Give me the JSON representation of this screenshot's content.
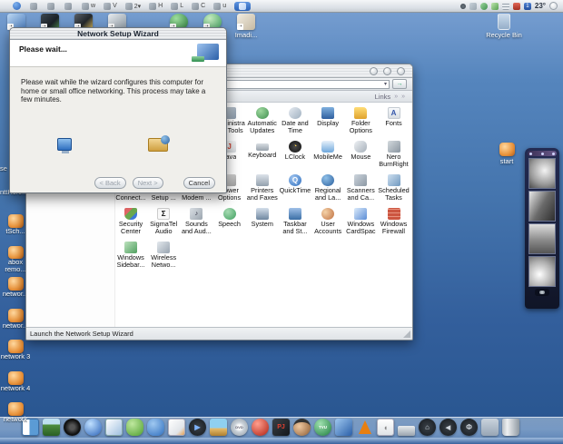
{
  "menubar": {
    "temperature": "23°",
    "extras": [
      {
        "icon": "menu-grid"
      },
      {
        "icon": "menu-disc"
      },
      {
        "icon": "menu-doc"
      },
      {
        "icon": "menu-drive",
        "label": "w"
      },
      {
        "icon": "menu-display",
        "label": "V"
      },
      {
        "icon": "menu-orb",
        "label": "2▾"
      },
      {
        "icon": "menu-orb2",
        "label": "H"
      },
      {
        "icon": "menu-sq",
        "label": "L"
      },
      {
        "icon": "menu-sq2",
        "label": "C"
      },
      {
        "icon": "menu-up",
        "label": "u"
      }
    ],
    "active_extra": {
      "icon": "menu-keyboard"
    },
    "tray": [
      {
        "icon": "tray-dot"
      },
      {
        "icon": "tray-net"
      },
      {
        "icon": "tray-user-green"
      },
      {
        "icon": "tray-win-green"
      },
      {
        "icon": "tray-eq"
      },
      {
        "icon": "tray-battery-red"
      },
      {
        "icon": "tray-lang-blue",
        "label": "1"
      }
    ]
  },
  "desktop": {
    "top_shortcuts_a": [
      {
        "icon": "app-blue",
        "label": ""
      },
      {
        "icon": "app-dark",
        "label": ""
      },
      {
        "icon": "app-yellow",
        "label": ""
      },
      {
        "icon": "app-gray",
        "label": ""
      }
    ],
    "top_shortcuts_b": [
      {
        "icon": "orb-green",
        "label": ""
      },
      {
        "icon": "sphere-green",
        "label": ""
      },
      {
        "icon": "app-light",
        "label": "Imadi..."
      }
    ],
    "left_fragments": [
      {
        "text": "se"
      },
      {
        "text": "nttHcro..."
      }
    ],
    "left_icons": [
      {
        "label": "tSch..."
      },
      {
        "label": "abox remo..."
      },
      {
        "label": "networ..."
      },
      {
        "label": "networ..."
      },
      {
        "label": "network 3"
      },
      {
        "label": "network 4"
      },
      {
        "label": "network"
      }
    ],
    "recycle_bin_label": "Recycle Bin",
    "start_label": "start"
  },
  "wizard": {
    "title": "Network Setup Wizard",
    "header": "Please wait...",
    "body": "Please wait while the wizard configures this computer for home or small office networking. This process may take a few minutes.",
    "back_label": "< Back",
    "next_label": "Next >",
    "cancel_label": "Cancel"
  },
  "cp_window": {
    "links_label": "Links",
    "chevron": "»",
    "go_label": "→",
    "dropdown_arrow": "▾",
    "status": "Launch the Network Setup Wizard",
    "items": [
      {
        "label": "",
        "icon": "blank"
      },
      {
        "label": "",
        "icon": "blank"
      },
      {
        "label": "",
        "icon": "blank"
      },
      {
        "label": "Administrative Tools",
        "icon": "admin"
      },
      {
        "label": "Automatic Updates",
        "icon": "updates"
      },
      {
        "label": "Date and Time",
        "icon": "datetime"
      },
      {
        "label": "Display",
        "icon": "display"
      },
      {
        "label": "Folder Options",
        "icon": "folder"
      },
      {
        "label": "Fonts",
        "icon": "fonts"
      },
      {
        "label": "",
        "icon": "blank"
      },
      {
        "label": "",
        "icon": "blank"
      },
      {
        "label": "",
        "icon": "blank"
      },
      {
        "label": "Java",
        "icon": "java"
      },
      {
        "label": "Keyboard",
        "icon": "keyboard"
      },
      {
        "label": "LClock",
        "icon": "lclock"
      },
      {
        "label": "MobileMe",
        "icon": "mobileme"
      },
      {
        "label": "Mouse",
        "icon": "mouse"
      },
      {
        "label": "Nero BurnRights",
        "icon": "nero"
      },
      {
        "label": "Network Connect...",
        "icon": "netconn"
      },
      {
        "label": "Network Setup ...",
        "icon": "netsetup"
      },
      {
        "label": "Phone and Modem ...",
        "icon": "modem"
      },
      {
        "label": "Power Options",
        "icon": "power"
      },
      {
        "label": "Printers and Faxes",
        "icon": "printers"
      },
      {
        "label": "QuickTime",
        "icon": "quicktime"
      },
      {
        "label": "Regional and La...",
        "icon": "regional"
      },
      {
        "label": "Scanners and Ca...",
        "icon": "scanners"
      },
      {
        "label": "Scheduled Tasks",
        "icon": "tasks"
      },
      {
        "label": "Security Center",
        "icon": "security"
      },
      {
        "label": "SigmaTel Audio",
        "icon": "sigmatel"
      },
      {
        "label": "Sounds and Aud...",
        "icon": "sounds"
      },
      {
        "label": "Speech",
        "icon": "speech"
      },
      {
        "label": "System",
        "icon": "system"
      },
      {
        "label": "Taskbar and St...",
        "icon": "taskbar"
      },
      {
        "label": "User Accounts",
        "icon": "users"
      },
      {
        "label": "Windows CardSpace",
        "icon": "cardspace"
      },
      {
        "label": "Windows Firewall",
        "icon": "firewall"
      },
      {
        "label": "Windows Sidebar...",
        "icon": "sidebar"
      },
      {
        "label": "Wireless Netwo...",
        "icon": "wireless"
      },
      {
        "label": "",
        "icon": "blank"
      },
      {
        "label": "",
        "icon": "blank"
      },
      {
        "label": "",
        "icon": "blank"
      },
      {
        "label": "",
        "icon": "blank"
      },
      {
        "label": "",
        "icon": "blank"
      },
      {
        "label": "",
        "icon": "blank"
      },
      {
        "label": "",
        "icon": "blank"
      }
    ]
  },
  "dock": {
    "icons": [
      {
        "icon": "finder"
      },
      {
        "icon": "terrain"
      },
      {
        "icon": "record"
      },
      {
        "icon": "globe"
      },
      {
        "icon": "photos"
      },
      {
        "icon": "android"
      },
      {
        "icon": "buddies"
      },
      {
        "icon": "notes"
      },
      {
        "icon": "qtplay"
      },
      {
        "icon": "palm"
      },
      {
        "icon": "dvd"
      },
      {
        "icon": "redorb"
      },
      {
        "icon": "pj"
      },
      {
        "icon": "pirate"
      },
      {
        "icon": "tvu"
      },
      {
        "icon": "tvplayer"
      },
      {
        "icon": "vlc"
      },
      {
        "icon": "applebox"
      },
      {
        "icon": "drive"
      },
      {
        "icon": "homeorb"
      },
      {
        "icon": "backorb"
      },
      {
        "icon": "powerorb"
      },
      {
        "icon": "winpanel"
      },
      {
        "icon": "trash"
      }
    ]
  }
}
